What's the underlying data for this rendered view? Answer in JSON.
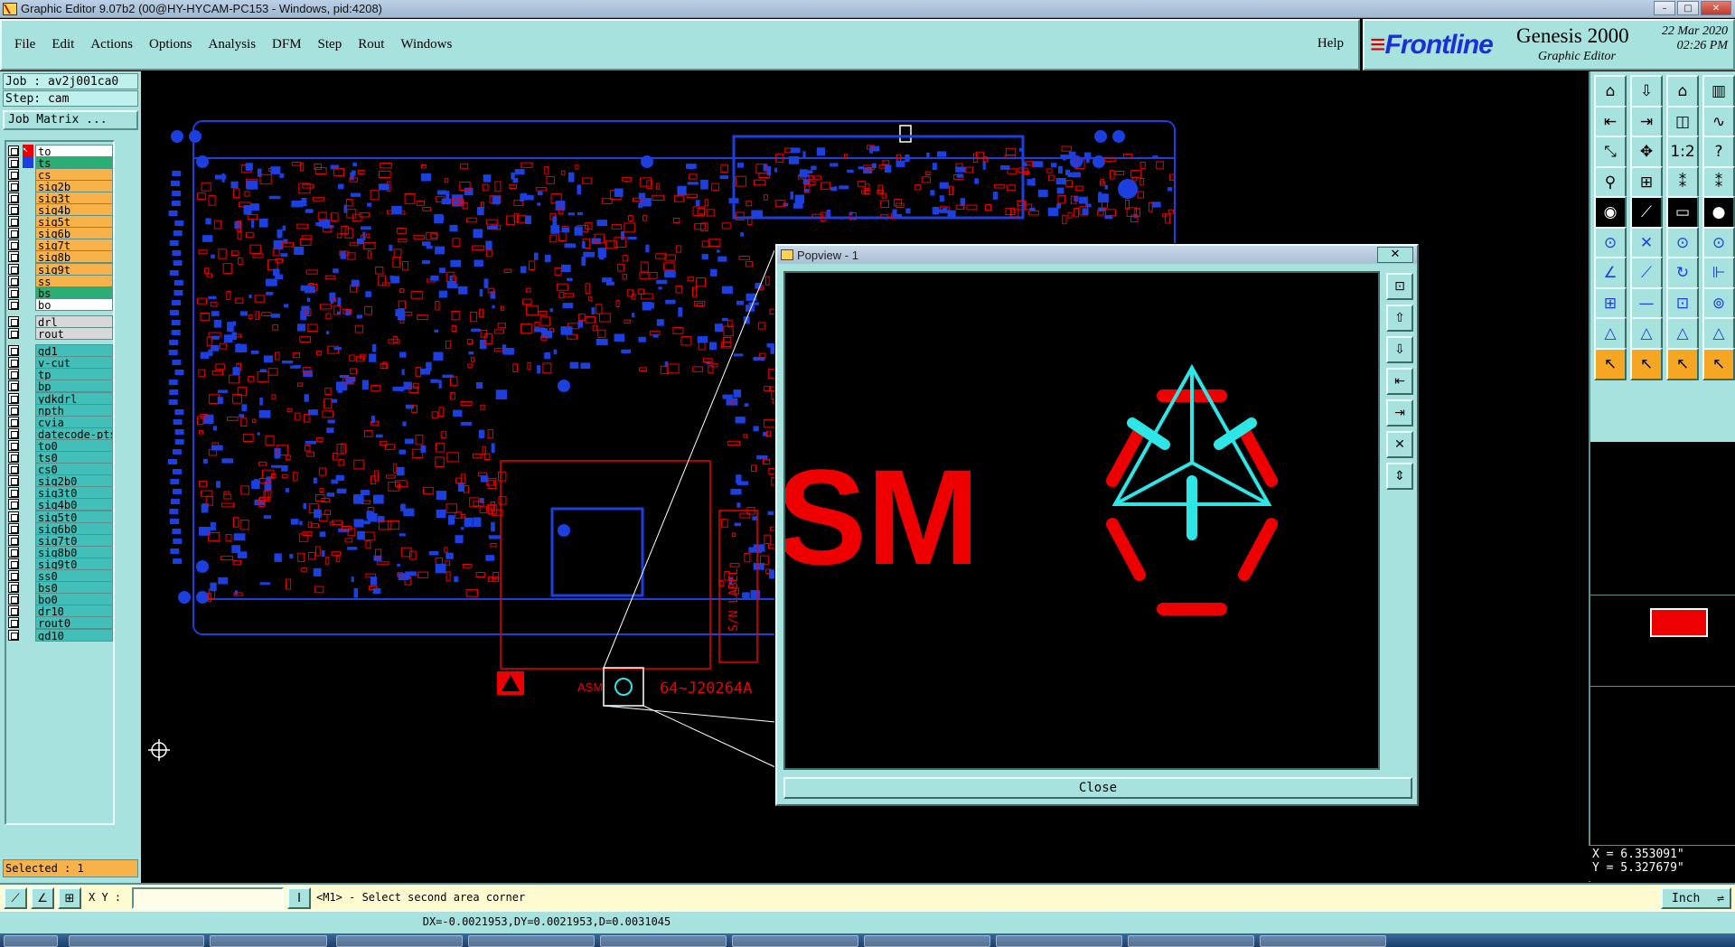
{
  "window": {
    "title": "Graphic Editor 9.07b2 (00@HY-HYCAM-PC153 - Windows, pid:4208)",
    "controls": [
      "–",
      "□",
      "✕"
    ]
  },
  "menu": {
    "items": [
      "File",
      "Edit",
      "Actions",
      "Options",
      "Analysis",
      "DFM",
      "Step",
      "Rout",
      "Windows"
    ],
    "help": "Help"
  },
  "brand": {
    "logo": "Frontline",
    "product": "Genesis 2000",
    "subtitle": "Graphic Editor",
    "date": "22 Mar 2020",
    "time": "02:26 PM"
  },
  "job": {
    "job_label": "Job : av2j001ca0",
    "step_label": "Step: cam",
    "matrix_button": "Job Matrix ..."
  },
  "layers": [
    {
      "name": "to",
      "style": "white",
      "arrow": "⇐",
      "marker": "red"
    },
    {
      "name": "ts",
      "style": "green",
      "arrow": "",
      "marker": "blue"
    },
    {
      "name": "cs",
      "style": "orange",
      "arrow": "⇐",
      "marker": ""
    },
    {
      "name": "sig2b",
      "style": "orange",
      "arrow": "⇐",
      "marker": ""
    },
    {
      "name": "sig3t",
      "style": "orange",
      "arrow": "⇐",
      "marker": ""
    },
    {
      "name": "sig4b",
      "style": "orange",
      "arrow": "⇐",
      "marker": ""
    },
    {
      "name": "sig5t",
      "style": "orange",
      "arrow": "⇐",
      "marker": ""
    },
    {
      "name": "sig6b",
      "style": "orange",
      "arrow": "⇐",
      "marker": ""
    },
    {
      "name": "sig7t",
      "style": "orange",
      "arrow": "⇐",
      "marker": ""
    },
    {
      "name": "sig8b",
      "style": "orange",
      "arrow": "⇐",
      "marker": ""
    },
    {
      "name": "sig9t",
      "style": "orange",
      "arrow": "⇐",
      "marker": ""
    },
    {
      "name": "ss",
      "style": "orange",
      "arrow": "⇐",
      "marker": ""
    },
    {
      "name": "bs",
      "style": "green",
      "arrow": "",
      "marker": ""
    },
    {
      "name": "bo",
      "style": "white",
      "arrow": "⇐",
      "marker": ""
    },
    {
      "name": "drl",
      "style": "grey",
      "arrow": "",
      "marker": ""
    },
    {
      "name": "rout",
      "style": "grey",
      "arrow": "",
      "marker": ""
    },
    {
      "name": "gd1",
      "style": "cyan",
      "arrow": "⇐",
      "marker": ""
    },
    {
      "name": "v-cut",
      "style": "cyan",
      "arrow": "",
      "marker": ""
    },
    {
      "name": "tp",
      "style": "cyan",
      "arrow": "",
      "marker": ""
    },
    {
      "name": "bp",
      "style": "cyan",
      "arrow": "",
      "marker": ""
    },
    {
      "name": "ydkdrl",
      "style": "cyan",
      "arrow": "",
      "marker": ""
    },
    {
      "name": "npth",
      "style": "cyan",
      "arrow": "",
      "marker": ""
    },
    {
      "name": "cvia",
      "style": "cyan",
      "arrow": "",
      "marker": ""
    },
    {
      "name": "datecode-pts",
      "style": "cyan",
      "arrow": "",
      "marker": ""
    },
    {
      "name": "to0",
      "style": "cyan",
      "arrow": "⇐",
      "marker": ""
    },
    {
      "name": "ts0",
      "style": "cyan",
      "arrow": "",
      "marker": ""
    },
    {
      "name": "cs0",
      "style": "cyan",
      "arrow": "⇐",
      "marker": ""
    },
    {
      "name": "sig2b0",
      "style": "cyan",
      "arrow": "⇐",
      "marker": ""
    },
    {
      "name": "sig3t0",
      "style": "cyan",
      "arrow": "⇐",
      "marker": ""
    },
    {
      "name": "sig4b0",
      "style": "cyan",
      "arrow": "⇐",
      "marker": ""
    },
    {
      "name": "sig5t0",
      "style": "cyan",
      "arrow": "⇐",
      "marker": ""
    },
    {
      "name": "sig6b0",
      "style": "cyan",
      "arrow": "⇐",
      "marker": ""
    },
    {
      "name": "sig7t0",
      "style": "cyan",
      "arrow": "⇐",
      "marker": ""
    },
    {
      "name": "sig8b0",
      "style": "cyan",
      "arrow": "⇐",
      "marker": ""
    },
    {
      "name": "sig9t0",
      "style": "cyan",
      "arrow": "⇐",
      "marker": ""
    },
    {
      "name": "ss0",
      "style": "cyan",
      "arrow": "⇐",
      "marker": ""
    },
    {
      "name": "bs0",
      "style": "cyan",
      "arrow": "",
      "marker": ""
    },
    {
      "name": "bo0",
      "style": "cyan",
      "arrow": "⇐",
      "marker": ""
    },
    {
      "name": "dr10",
      "style": "cyan",
      "arrow": "",
      "marker": ""
    },
    {
      "name": "rout0",
      "style": "cyan",
      "arrow": "",
      "marker": ""
    },
    {
      "name": "gd10",
      "style": "cyan",
      "arrow": "⇐",
      "marker": ""
    }
  ],
  "selected": "Selected : 1",
  "canvas": {
    "board_text": "64~J20264A",
    "asm_text": "ASM",
    "label_text": "S/N LABEL"
  },
  "popview": {
    "title": "Popview - 1",
    "close_x": "✕",
    "zoom_text": "SM",
    "close_button": "Close",
    "tools": [
      "zoom-fit-icon",
      "home-icon",
      "zoom-home-icon",
      "pan-left-icon",
      "pan-right-icon",
      "zoom-out-icon",
      "zoom-in-icon"
    ]
  },
  "right_tools": [
    "home-icon",
    "zoom-home-icon",
    "house-icon",
    "panel-icon",
    "pan-left-icon",
    "pan-right-icon",
    "fit-icon",
    "wave-icon",
    "zoom-out-icon",
    "zoom-in-icon",
    "ratio-icon",
    "help-icon",
    "snap-icon",
    "grid-icon",
    "measure-icon",
    "drill-icon",
    "add-pad-icon",
    "add-line-icon",
    "ruler-icon",
    "circle-icon",
    "move-icon",
    "delete-icon",
    "copy-icon",
    "connect-icon",
    "draw-line-icon",
    "edit-line-icon",
    "arc-icon",
    "layers-icon",
    "pad-edit-icon",
    "cut-icon",
    "resize-icon",
    "transform-icon",
    "triangle-icon",
    "triangle2-icon",
    "triangle3-icon",
    "triangle4-icon",
    "select-icon",
    "select2-icon",
    "select3-icon",
    "select4-icon"
  ],
  "ratio_label": "1:2",
  "help_label": "?",
  "coords": {
    "x": "X = 6.353091\"",
    "y": "Y = 5.327679\""
  },
  "bottom": {
    "xy_label": "X Y :",
    "xy_value": "",
    "prompt": "<M1> - Select second area corner",
    "unit": "Inch",
    "status": "DX=-0.0021953,DY=0.0021953,D=0.0031045"
  },
  "colors": {
    "panel": "#a8e2de",
    "board_outline": "#1c3fe0",
    "copper_red": "#e00000",
    "pad_blue": "#1c3fe0",
    "logo_cyan": "#2ee6e6",
    "orange_layer": "#f7b24a",
    "green_layer": "#2bae73"
  }
}
